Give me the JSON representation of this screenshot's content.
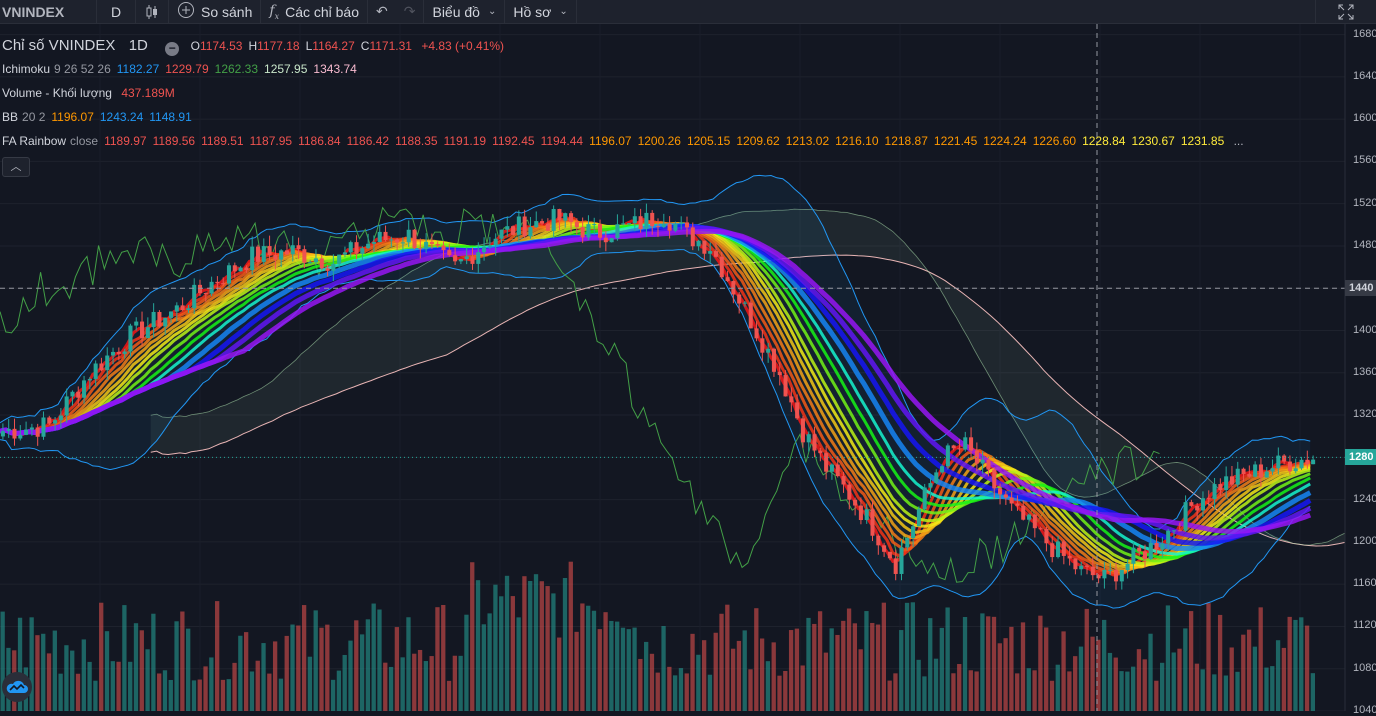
{
  "toolbar": {
    "symbol": "VNINDEX",
    "interval": "D",
    "compare": "So sánh",
    "indicators": "Các chỉ báo",
    "chart_menu": "Biểu đồ",
    "profile_menu": "Hồ sơ"
  },
  "legend": {
    "title": "Chỉ số VNINDEX",
    "interval": "1D",
    "ohlc": [
      {
        "label": "O",
        "value": "1174.53"
      },
      {
        "label": "H",
        "value": "1177.18"
      },
      {
        "label": "L",
        "value": "1164.27"
      },
      {
        "label": "C",
        "value": "1171.31"
      }
    ],
    "change": "+4.83 (+0.41%)",
    "ichimoku": {
      "name": "Ichimoku",
      "params": "9 26 52 26",
      "values": [
        {
          "v": "1182.27",
          "color": "#2196f3"
        },
        {
          "v": "1229.79",
          "color": "#ef5350"
        },
        {
          "v": "1262.33",
          "color": "#43a047"
        },
        {
          "v": "1257.95",
          "color": "#c8e6c9"
        },
        {
          "v": "1343.74",
          "color": "#f8bbd0"
        }
      ]
    },
    "volume": {
      "name": "Volume - Khối lượng",
      "value": "437.189M"
    },
    "bb": {
      "name": "BB",
      "params": "20 2",
      "values": [
        {
          "v": "1196.07",
          "color": "#ff9800"
        },
        {
          "v": "1243.24",
          "color": "#2196f3"
        },
        {
          "v": "1148.91",
          "color": "#2196f3"
        }
      ]
    },
    "rainbow": {
      "name": "FA Rainbow",
      "params": "close",
      "values": [
        {
          "v": "1189.97",
          "color": "#ef5350"
        },
        {
          "v": "1189.56",
          "color": "#ef5350"
        },
        {
          "v": "1189.51",
          "color": "#ef5350"
        },
        {
          "v": "1187.95",
          "color": "#ef5350"
        },
        {
          "v": "1186.84",
          "color": "#ef5350"
        },
        {
          "v": "1186.42",
          "color": "#ef5350"
        },
        {
          "v": "1188.35",
          "color": "#ef5350"
        },
        {
          "v": "1191.19",
          "color": "#ef5350"
        },
        {
          "v": "1192.45",
          "color": "#ef5350"
        },
        {
          "v": "1194.44",
          "color": "#ef5350"
        },
        {
          "v": "1196.07",
          "color": "#ff9800"
        },
        {
          "v": "1200.26",
          "color": "#ff9800"
        },
        {
          "v": "1205.15",
          "color": "#ff9800"
        },
        {
          "v": "1209.62",
          "color": "#ff9800"
        },
        {
          "v": "1213.02",
          "color": "#ff9800"
        },
        {
          "v": "1216.10",
          "color": "#ff9800"
        },
        {
          "v": "1218.87",
          "color": "#ff9800"
        },
        {
          "v": "1221.45",
          "color": "#ff9800"
        },
        {
          "v": "1224.24",
          "color": "#ff9800"
        },
        {
          "v": "1226.60",
          "color": "#ff9800"
        },
        {
          "v": "1228.84",
          "color": "#ffeb3b"
        },
        {
          "v": "1230.67",
          "color": "#ffeb3b"
        },
        {
          "v": "1231.85",
          "color": "#ffeb3b"
        }
      ],
      "more": "..."
    }
  },
  "axis": {
    "ticks": [
      1680,
      1640,
      1600,
      1560,
      1520,
      1480,
      1440,
      1400,
      1360,
      1320,
      1280,
      1240,
      1200,
      1160,
      1120,
      1080,
      1040
    ],
    "crosshair_label": "1440",
    "last_price_label": "1280",
    "range": [
      1040,
      1690
    ]
  },
  "chart_data": {
    "type": "candlestick",
    "price_path": [
      [
        0,
        1305
      ],
      [
        8,
        1310
      ],
      [
        15,
        1360
      ],
      [
        22,
        1395
      ],
      [
        30,
        1420
      ],
      [
        36,
        1445
      ],
      [
        43,
        1470
      ],
      [
        50,
        1475
      ],
      [
        57,
        1465
      ],
      [
        64,
        1485
      ],
      [
        70,
        1490
      ],
      [
        75,
        1470
      ],
      [
        78,
        1460
      ],
      [
        84,
        1487
      ],
      [
        90,
        1500
      ],
      [
        96,
        1505
      ],
      [
        102,
        1492
      ],
      [
        108,
        1498
      ],
      [
        114,
        1510
      ],
      [
        118,
        1490
      ],
      [
        122,
        1480
      ],
      [
        126,
        1440
      ],
      [
        130,
        1400
      ],
      [
        134,
        1360
      ],
      [
        138,
        1305
      ],
      [
        142,
        1270
      ],
      [
        146,
        1245
      ],
      [
        150,
        1215
      ],
      [
        154,
        1180
      ],
      [
        158,
        1230
      ],
      [
        162,
        1280
      ],
      [
        166,
        1290
      ],
      [
        170,
        1260
      ],
      [
        174,
        1230
      ],
      [
        178,
        1210
      ],
      [
        182,
        1190
      ],
      [
        186,
        1172
      ],
      [
        190,
        1165
      ],
      [
        194,
        1180
      ],
      [
        198,
        1195
      ],
      [
        202,
        1215
      ],
      [
        206,
        1240
      ],
      [
        210,
        1255
      ],
      [
        214,
        1262
      ],
      [
        218,
        1270
      ],
      [
        222,
        1276
      ],
      [
        226,
        1280
      ]
    ],
    "candle_count": 227,
    "colors": {
      "up": "#26a69a",
      "down": "#ef5350"
    }
  }
}
